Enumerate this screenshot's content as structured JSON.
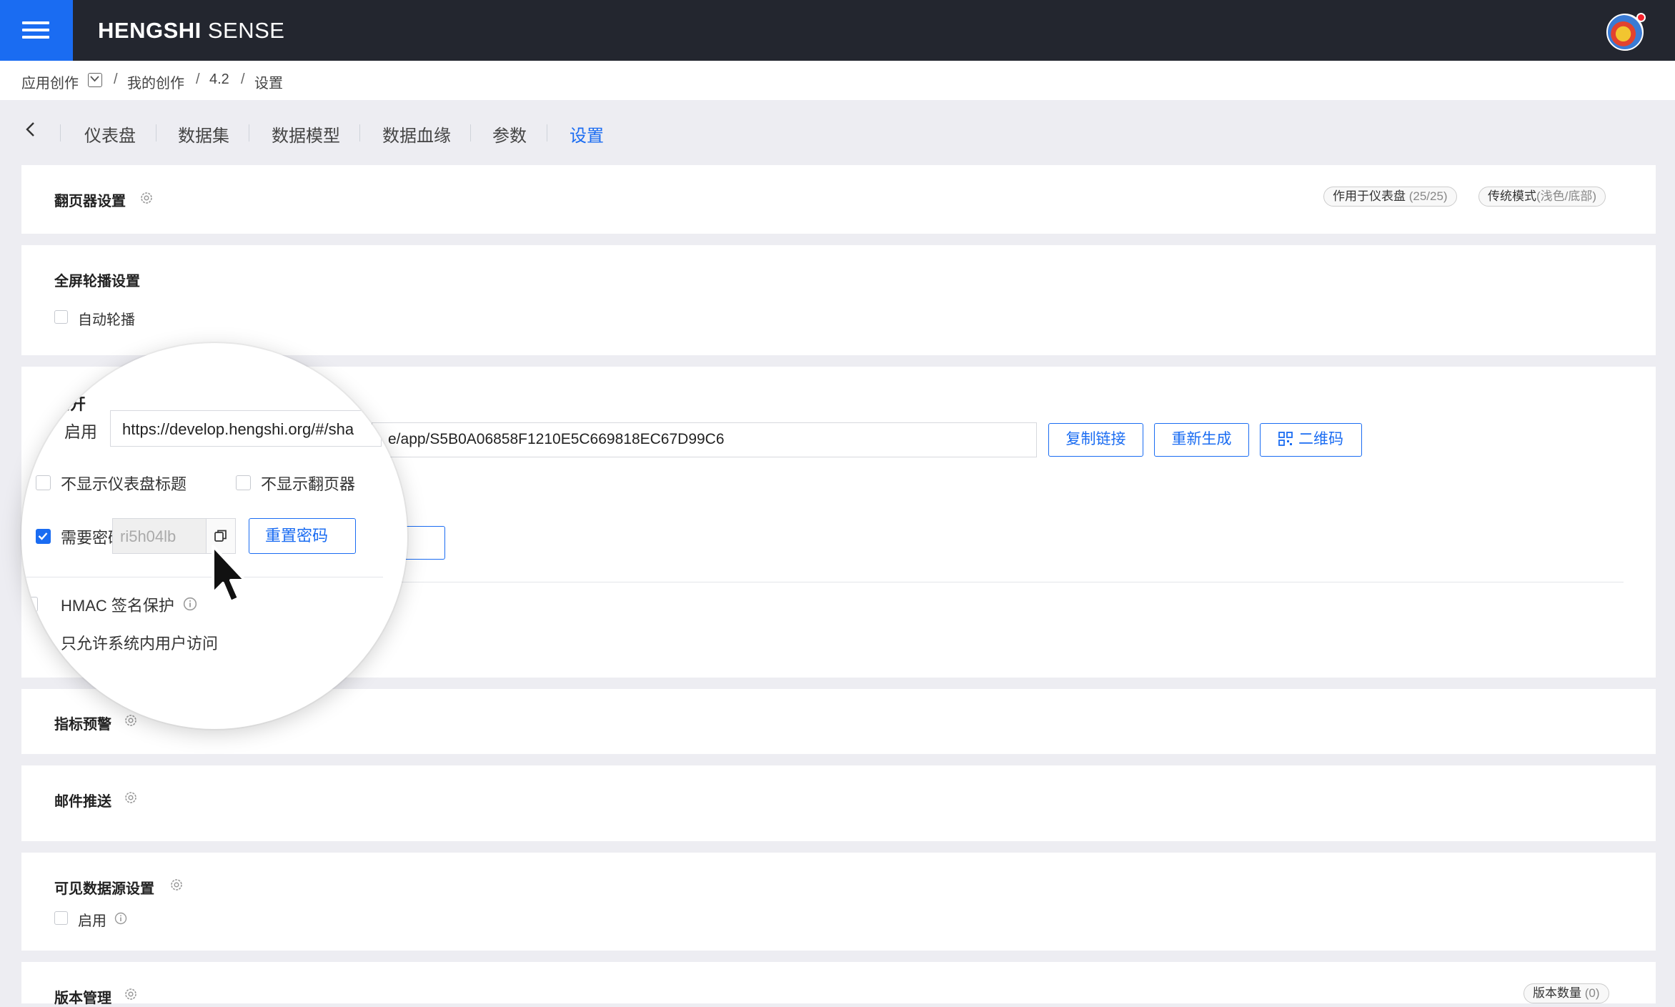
{
  "header": {
    "brand_bold": "HENGSHI",
    "brand_light": " SENSE",
    "menu_icon": "hamburger-icon",
    "avatar_icon": "user-avatar-icon"
  },
  "breadcrumb": {
    "items": [
      "应用创作",
      "我的创作",
      "4.2",
      "设置"
    ],
    "separator": "/"
  },
  "tabs": {
    "back_icon": "chevron-left-icon",
    "items": [
      "仪表盘",
      "数据集",
      "数据模型",
      "数据血缘",
      "参数",
      "设置"
    ],
    "active": "设置"
  },
  "pager": {
    "title": "翻页器设置",
    "tag1_label": "作用于仪表盘",
    "tag1_count": "(25/25)",
    "tag2_label": "传统模式",
    "tag2_detail": "(浅色/底部)"
  },
  "fullscreen": {
    "title": "全屏轮播设置",
    "autoplay_label": "自动轮播",
    "autoplay_checked": false
  },
  "public": {
    "title": "公开",
    "enable_label": "启用",
    "url_visible": "e/app/S5B0A06858F1210E5C669818EC67D99C6",
    "url_zoomed": "https://develop.hengshi.org/#/sha",
    "copy_link_label": "复制链接",
    "regenerate_label": "重新生成",
    "qrcode_label": "二维码",
    "hide_title_label": "不显示仪表盘标题",
    "hide_pager_label": "不显示翻页器",
    "password_label": "需要密码访问",
    "password_checked": true,
    "password_value": "ri5h04lb",
    "reset_password_label": "重置密码",
    "hmac_label": "HMAC 签名保护",
    "internal_only_label": "只允许系统内用户访问",
    "accent_color": "#1a6cf2"
  },
  "alert": {
    "title": "指标预警"
  },
  "mail": {
    "title": "邮件推送"
  },
  "datasource": {
    "title": "可见数据源设置",
    "enable_label": "启用"
  },
  "version": {
    "title": "版本管理",
    "tag_label": "版本数量",
    "tag_count": "(0)"
  }
}
